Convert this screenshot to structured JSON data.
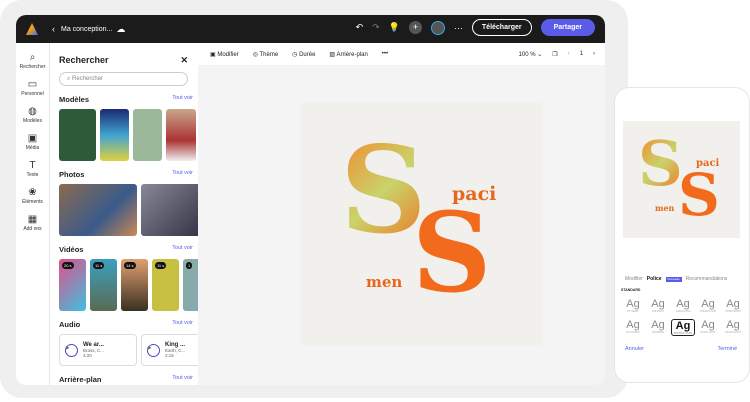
{
  "topbar": {
    "back": "‹",
    "title": "Ma conception...",
    "download": "Télécharger",
    "share": "Partager"
  },
  "rail": [
    {
      "icon": "⌕",
      "label": "Rechercher"
    },
    {
      "icon": "▭",
      "label": "Personnel"
    },
    {
      "icon": "◍",
      "label": "Modèles"
    },
    {
      "icon": "▣",
      "label": "Média"
    },
    {
      "icon": "T",
      "label": "Texte"
    },
    {
      "icon": "❀",
      "label": "Éléments"
    },
    {
      "icon": "▦",
      "label": "Add ons"
    }
  ],
  "panel": {
    "title": "Rechercher",
    "close": "✕",
    "search_placeholder": "Rechercher",
    "see_all": "Tout voir",
    "sections": {
      "models": "Modèles",
      "photos": "Photos",
      "videos": "Vidéos",
      "audio": "Audio",
      "background": "Arrière-plan"
    },
    "videos": [
      "20 s",
      "11 s",
      "14 s",
      "11 s",
      "1"
    ],
    "audio": [
      {
        "title": "We ar...",
        "artist": "Brass, C...",
        "time": "4:20"
      },
      {
        "title": "King ...",
        "artist": "Earth, C...",
        "time": "2:15"
      }
    ]
  },
  "toolbar": {
    "edit": "Modifier",
    "theme": "Thème",
    "duration": "Durée",
    "background": "Arrière-plan",
    "more": "•••",
    "zoom": "100 %",
    "page": "1"
  },
  "design": {
    "word1": "paci",
    "word2": "men",
    "accent": "#f26b1d"
  },
  "phone": {
    "tabs": [
      "Modifier",
      "Police",
      "Recommandations"
    ],
    "new_badge": "Nouveauté",
    "section": "STANDARD",
    "fonts": [
      "PT SERIF",
      "BALDWIN",
      "VARIATIONS",
      "STENCIL STD",
      "STORYBOOK",
      "QUOTABLE",
      "SCRIBBLE",
      "SOURCE SANS",
      "STRIP LIGHT",
      "TRUE NORTH"
    ],
    "cancel": "Annuler",
    "done": "Terminé"
  }
}
